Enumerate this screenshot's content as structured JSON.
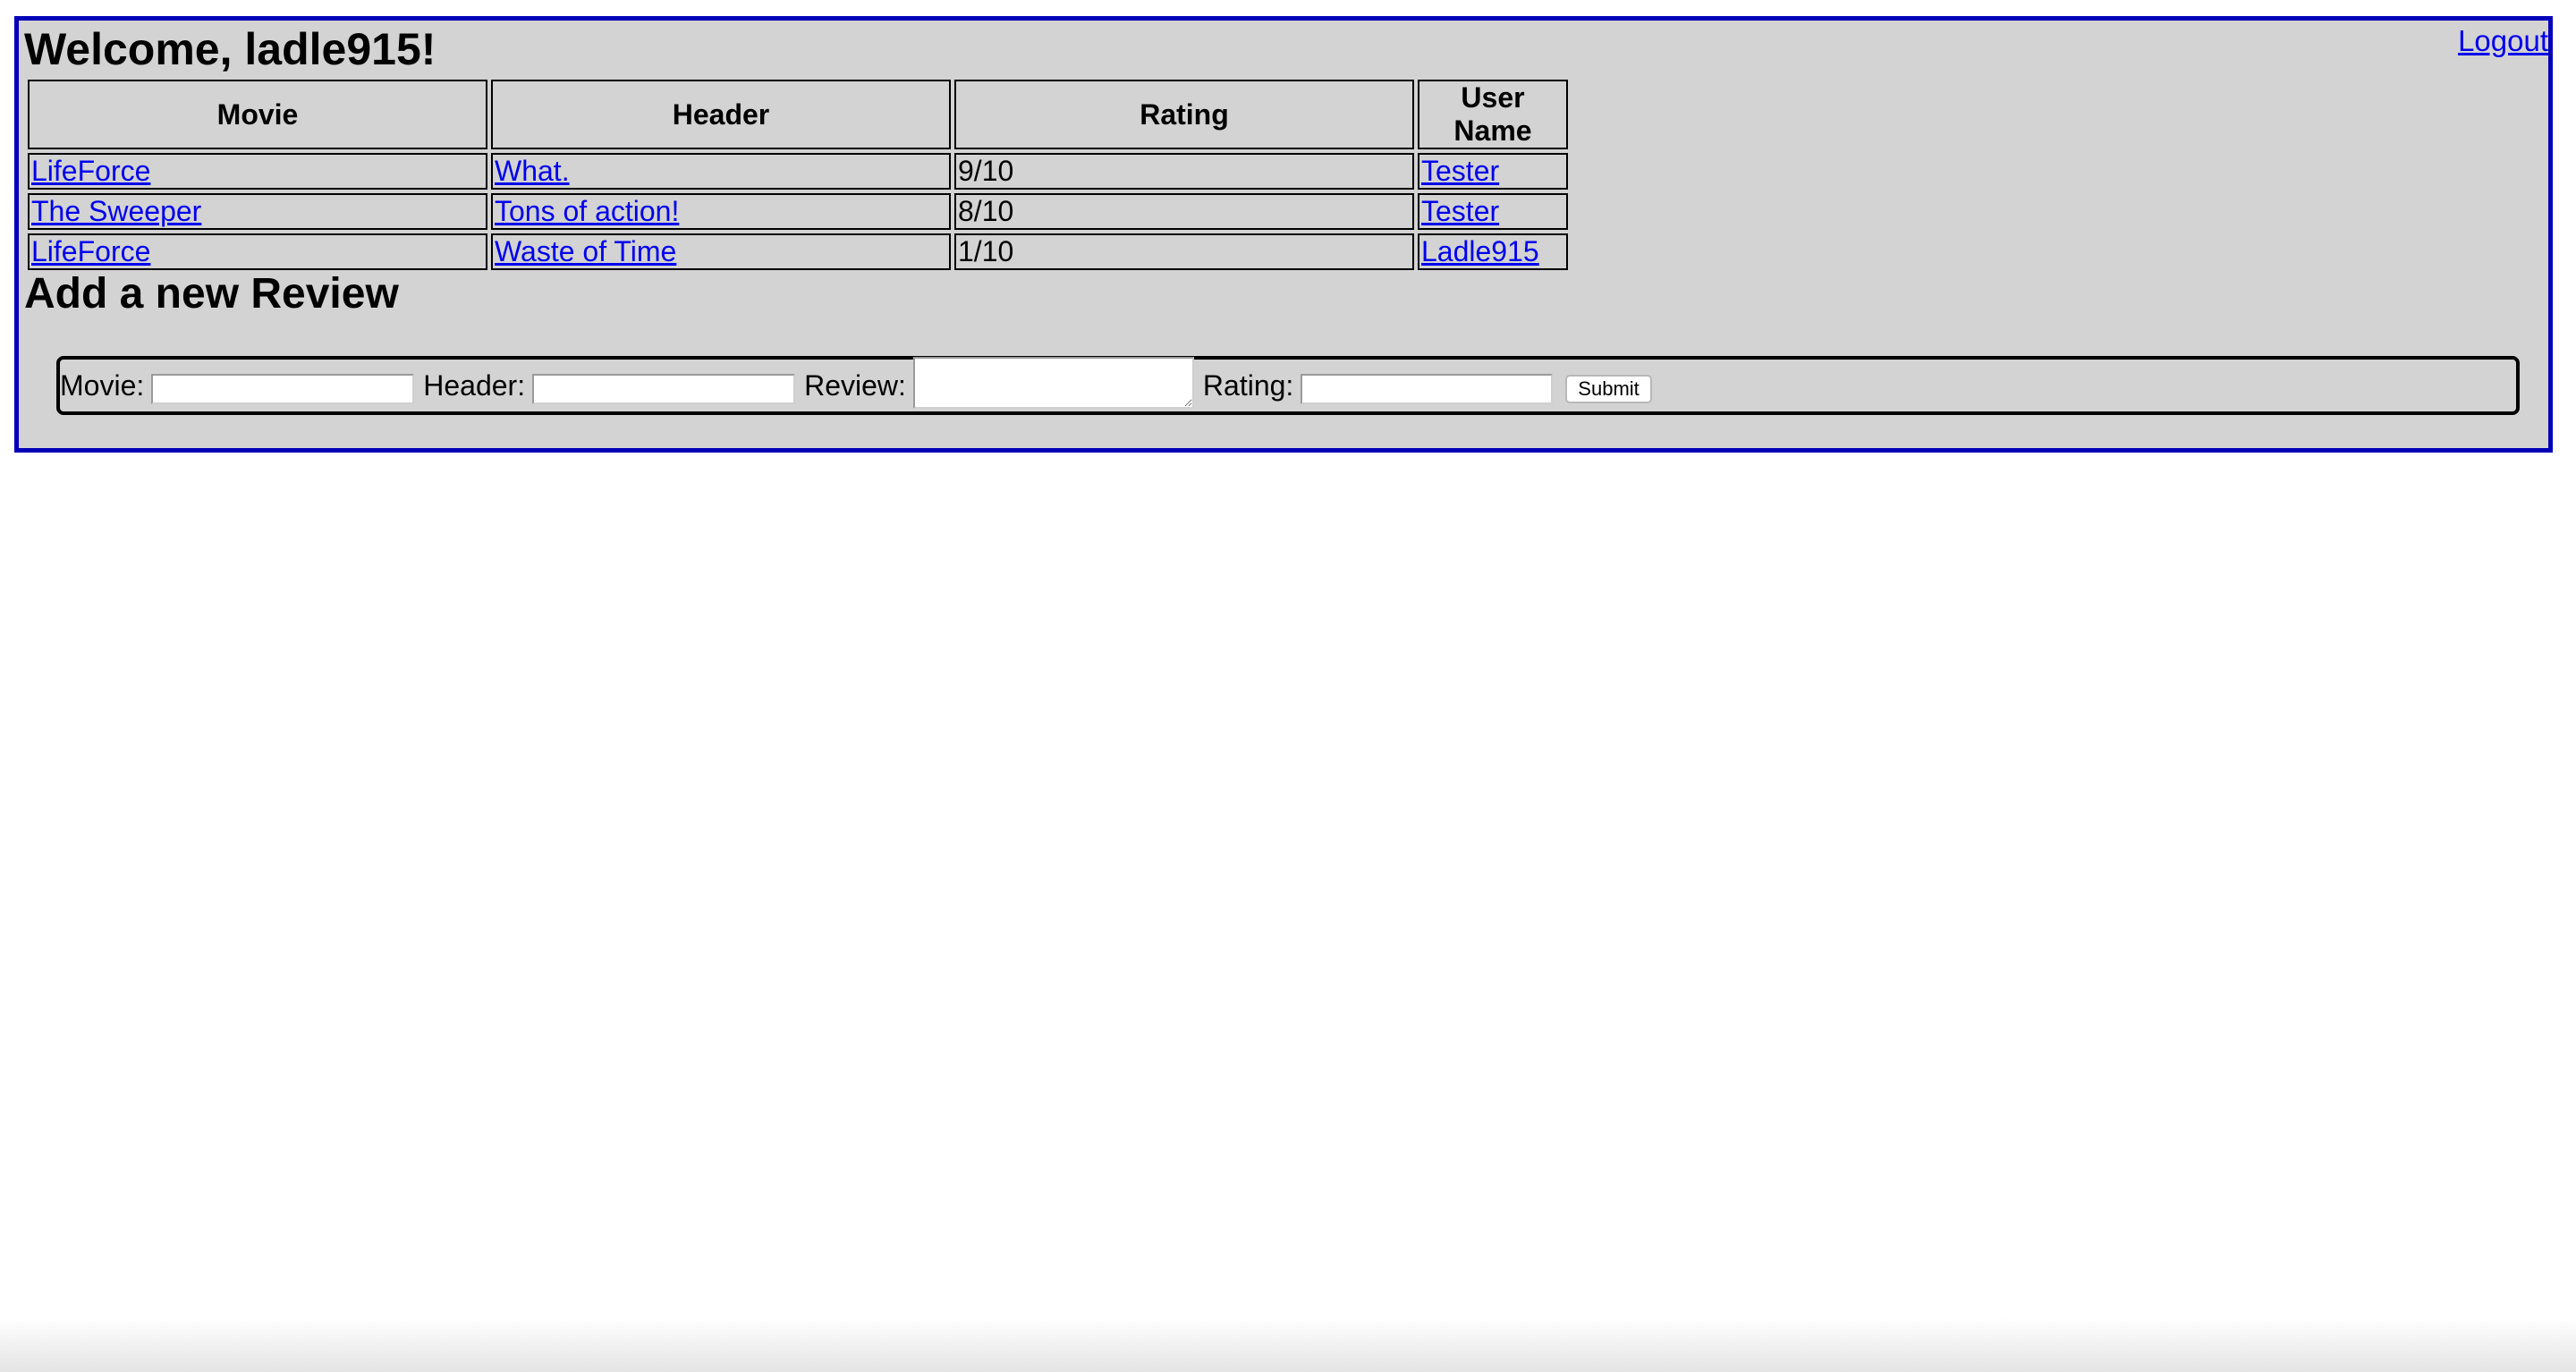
{
  "page": {
    "title": "Welcome, ladle915!",
    "logout_label": "Logout"
  },
  "table": {
    "headers": {
      "movie": "Movie",
      "header": "Header",
      "rating": "Rating",
      "user": "User Name"
    },
    "rows": [
      {
        "movie": "LifeForce",
        "header": "What.",
        "rating": "9/10",
        "user": "Tester"
      },
      {
        "movie": "The Sweeper",
        "header": "Tons of action!",
        "rating": "8/10",
        "user": "Tester"
      },
      {
        "movie": "LifeForce",
        "header": "Waste of Time",
        "rating": "1/10",
        "user": "Ladle915"
      }
    ]
  },
  "form": {
    "title": "Add a new Review",
    "movie_label": "Movie:",
    "header_label": "Header:",
    "review_label": "Review:",
    "rating_label": "Rating:",
    "movie_value": "",
    "header_value": "",
    "review_value": "",
    "rating_value": "",
    "submit_label": "Submit"
  },
  "colors": {
    "panel_bg": "#d3d3d3",
    "panel_border": "#0000b8",
    "link": "#0000ee"
  }
}
